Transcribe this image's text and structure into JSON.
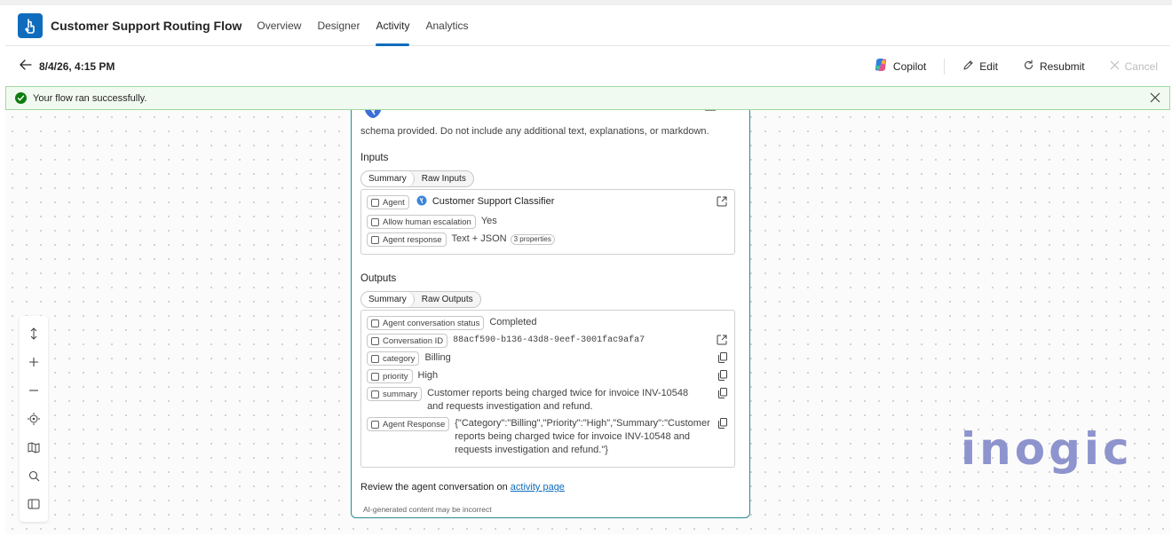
{
  "header": {
    "app_title": "Customer Support Routing Flow",
    "tabs": [
      {
        "label": "Overview",
        "active": false
      },
      {
        "label": "Designer",
        "active": false
      },
      {
        "label": "Activity",
        "active": true
      },
      {
        "label": "Analytics",
        "active": false
      }
    ]
  },
  "command_bar": {
    "run_time": "8/4/26, 4:15 PM",
    "copilot": "Copilot",
    "edit": "Edit",
    "resubmit": "Resubmit",
    "cancel": "Cancel"
  },
  "banner": {
    "message": "Your flow ran successfully.",
    "status_color": "#107c10"
  },
  "card": {
    "instruction_tail": "schema provided. Do not include any additional text, explanations, or markdown.",
    "inputs": {
      "title": "Inputs",
      "toggle": {
        "summary": "Summary",
        "raw": "Raw Inputs"
      },
      "rows": [
        {
          "label": "Agent",
          "value": "Customer Support Classifier"
        },
        {
          "label": "Allow human escalation",
          "value": "Yes"
        },
        {
          "label": "Agent response",
          "value": "Text + JSON",
          "badge": "3 properties"
        }
      ]
    },
    "outputs": {
      "title": "Outputs",
      "toggle": {
        "summary": "Summary",
        "raw": "Raw Outputs"
      },
      "rows": [
        {
          "label": "Agent conversation status",
          "value": "Completed"
        },
        {
          "label": "Conversation ID",
          "value": "88acf590-b136-43d8-9eef-3001fac9afa7"
        },
        {
          "label": "category",
          "value": "Billing"
        },
        {
          "label": "priority",
          "value": "High"
        },
        {
          "label": "summary",
          "value": "Customer reports being charged twice for invoice INV-10548 and requests investigation and refund."
        },
        {
          "label": "Agent Response",
          "value": "{\"Category\":\"Billing\",\"Priority\":\"High\",\"Summary\":\"Customer reports being charged twice for invoice INV-10548 and requests investigation and refund.\"}"
        }
      ]
    },
    "review_text": "Review the agent conversation on",
    "review_link": "activity page",
    "disclaimer": "AI-generated content may be incorrect"
  },
  "toolbar_icons": [
    "fit-height-icon",
    "zoom-in-icon",
    "zoom-out-icon",
    "recenter-icon",
    "minimap-icon",
    "search-icon",
    "panel-icon"
  ],
  "watermark": "inogic",
  "colors": {
    "accent": "#0f6cbd",
    "card_border": "#2b8a8f",
    "success": "#107c10"
  }
}
